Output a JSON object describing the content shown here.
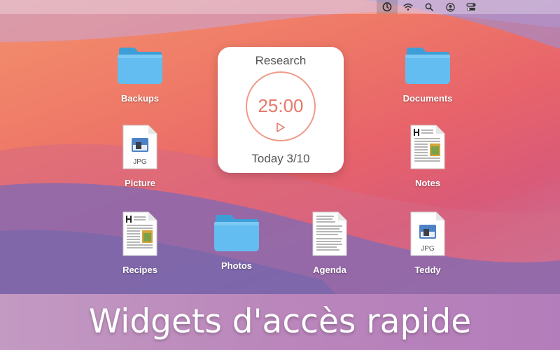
{
  "menubar": {
    "icons": [
      "timer-icon",
      "wifi-icon",
      "search-icon",
      "user-icon",
      "control-center-icon"
    ]
  },
  "desktop_items": [
    {
      "id": "backups",
      "label": "Backups",
      "kind": "folder"
    },
    {
      "id": "documents",
      "label": "Documents",
      "kind": "folder"
    },
    {
      "id": "picture",
      "label": "Picture",
      "kind": "jpg"
    },
    {
      "id": "notes",
      "label": "Notes",
      "kind": "rich-doc"
    },
    {
      "id": "recipes",
      "label": "Recipes",
      "kind": "rich-doc"
    },
    {
      "id": "photos",
      "label": "Photos",
      "kind": "folder"
    },
    {
      "id": "agenda",
      "label": "Agenda",
      "kind": "text-doc"
    },
    {
      "id": "teddy",
      "label": "Teddy",
      "kind": "jpg"
    }
  ],
  "file_badge": "JPG",
  "timer_widget": {
    "title": "Research",
    "time": "25:00",
    "footer": "Today 3/10",
    "accent": "#e7796a"
  },
  "banner": {
    "caption": "Widgets d'accès rapide"
  }
}
